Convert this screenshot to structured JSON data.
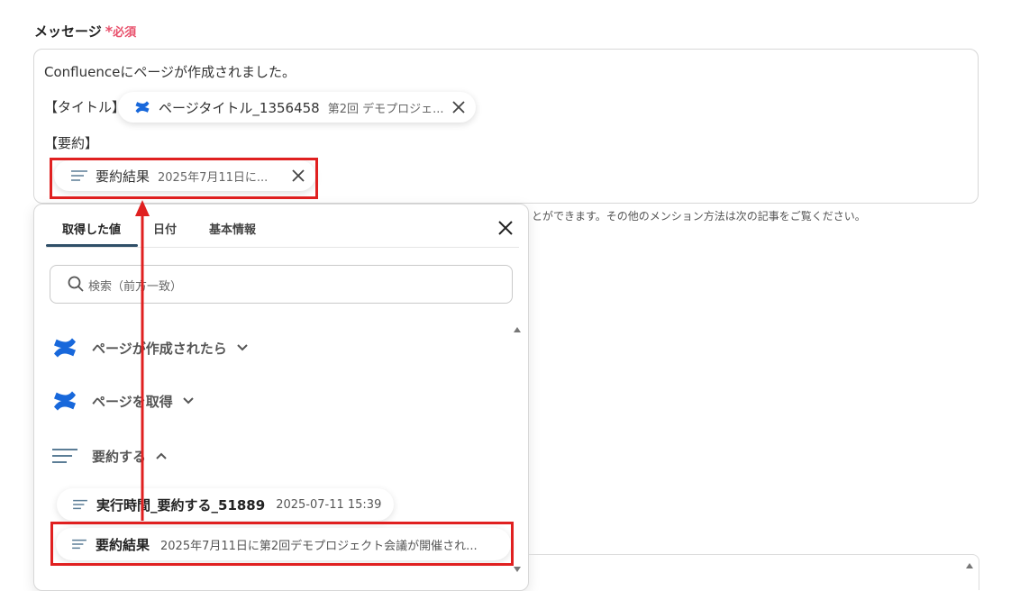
{
  "field": {
    "label": "メッセージ",
    "required_mark": "*",
    "required_text": "必須"
  },
  "message": {
    "line1": "Confluenceにページが作成されました。",
    "title_label": "【タイトル】",
    "summary_label": "【要約】",
    "title_chip": {
      "main": "ページタイトル_1356458",
      "sub": "第2回 デモプロジェ..."
    },
    "summary_chip": {
      "main": "要約結果",
      "sub": "2025年7月11日に..."
    }
  },
  "helper_text": "とができます。その他のメンション方法は次の記事をご覧ください。",
  "panel": {
    "tabs": [
      {
        "label": "取得した値",
        "active": true
      },
      {
        "label": "日付",
        "active": false
      },
      {
        "label": "基本情報",
        "active": false
      }
    ],
    "search_placeholder": "検索（前方一致）",
    "groups": [
      {
        "label": "ページが作成されたら",
        "icon": "confluence-icon",
        "expanded": false
      },
      {
        "label": "ページを取得",
        "icon": "confluence-icon",
        "expanded": false
      },
      {
        "label": "要約する",
        "icon": "summary-lines-icon",
        "expanded": true
      }
    ],
    "items": [
      {
        "main": "実行時間_要約する_51889",
        "sub": "2025-07-11 15:39"
      },
      {
        "main": "要約結果",
        "sub": "2025年7月11日に第2回デモプロジェクト会議が開催され..."
      }
    ]
  },
  "colors": {
    "accent": "#2f4f68",
    "required": "#e8506b",
    "highlight": "#e02020",
    "confluence_blue": "#1868db"
  }
}
